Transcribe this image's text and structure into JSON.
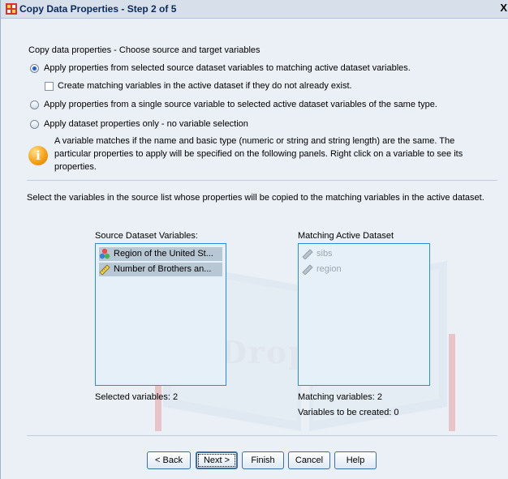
{
  "window": {
    "title": "Copy Data Properties - Step 2 of 5",
    "close_glyph": "X"
  },
  "section_heading": "Copy data properties - Choose source and target variables",
  "options": [
    {
      "label": "Apply properties from selected source dataset variables to matching active dataset variables.",
      "checked": true
    },
    {
      "label": "Apply properties from a single source variable to selected active dataset variables of the same type.",
      "checked": false
    },
    {
      "label": "Apply dataset properties only - no variable selection",
      "checked": false
    }
  ],
  "create_checkbox": {
    "label": "Create matching variables in the active dataset if they do not already  exist.",
    "checked": false
  },
  "info": {
    "icon": "info-icon",
    "text": "A variable matches if the name and basic type (numeric or string and string length) are the same. The particular properties to apply will be specified on the following panels. Right click on a variable to see its properties."
  },
  "instructions": "Select the variables in the source list whose properties will be copied to the matching variables in the active dataset.",
  "source": {
    "label": "Source Dataset Variables:",
    "items": [
      {
        "label": "Region of the United St...",
        "icon": "nominal-variable-icon"
      },
      {
        "label": "Number of Brothers an...",
        "icon": "scale-ruler-icon"
      }
    ],
    "count_label": "Selected variables: 2"
  },
  "target": {
    "label": "Matching Active Dataset",
    "items": [
      {
        "label": "sibs",
        "icon": "scale-ruler-icon"
      },
      {
        "label": "region",
        "icon": "scale-ruler-icon"
      }
    ],
    "matching_label": "Matching variables: 2",
    "created_label": "Variables to be created: 0"
  },
  "buttons": {
    "back": "< Back",
    "next": "Next >",
    "finish": "Finish",
    "cancel": "Cancel",
    "help": "Help"
  },
  "watermark": "DropBooks",
  "colors": {
    "accent": "#2a5cc6",
    "list_border": "#2d8ad8",
    "selection": "#b8c7d4",
    "background": "#eaf0f6"
  }
}
